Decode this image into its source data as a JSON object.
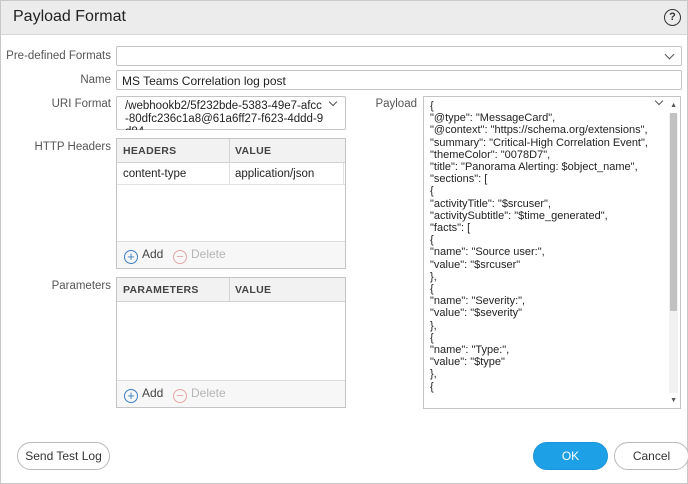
{
  "dialog": {
    "title": "Payload Format",
    "help_glyph": "?"
  },
  "form": {
    "predefined_label": "Pre-defined Formats",
    "predefined_value": "",
    "name_label": "Name",
    "name_value": "MS Teams Correlation log post",
    "uri_label": "URI Format",
    "uri_value": "/webhookb2/5f232bde-5383-49e7-afcc-80dfc236c1a8@61a6ff27-f623-4ddd-9d84",
    "http_headers_label": "HTTP Headers",
    "parameters_label": "Parameters",
    "payload_label": "Payload"
  },
  "headers_table": {
    "columns": [
      "HEADERS",
      "VALUE"
    ],
    "rows": [
      {
        "header": "content-type",
        "value": "application/json"
      }
    ],
    "add_label": "Add",
    "delete_label": "Delete"
  },
  "parameters_table": {
    "columns": [
      "PARAMETERS",
      "VALUE"
    ],
    "rows": [],
    "add_label": "Add",
    "delete_label": "Delete"
  },
  "payload": {
    "lines": [
      "{",
      "\"@type\": \"MessageCard\",",
      "\"@context\": \"https://schema.org/extensions\",",
      "\"summary\": \"Critical-High Correlation Event\",",
      "\"themeColor\": \"0078D7\",",
      "\"title\": \"Panorama Alerting: $object_name\",",
      "\"sections\": [",
      "{",
      "\"activityTitle\": \"$srcuser\",",
      "\"activitySubtitle\": \"$time_generated\",",
      "\"facts\": [",
      "{",
      "\"name\": \"Source user:\",",
      "\"value\": \"$srcuser\"",
      "},",
      "{",
      "\"name\": \"Severity:\",",
      "\"value\": \"$severity\"",
      "},",
      "{",
      "\"name\": \"Type:\",",
      "\"value\": \"$type\"",
      "},",
      "{"
    ]
  },
  "footer": {
    "send_test_log": "Send Test Log",
    "ok": "OK",
    "cancel": "Cancel"
  },
  "colors": {
    "primary_button": "#1ea0e6",
    "titlebar": "#ececec",
    "add_icon": "#3c7fc0",
    "delete_disabled": "#e3a7a7"
  },
  "icons": {
    "help": "help-circle-icon",
    "dropdown": "chevron-down-icon",
    "add": "plus-circle-icon",
    "delete": "minus-circle-icon"
  }
}
